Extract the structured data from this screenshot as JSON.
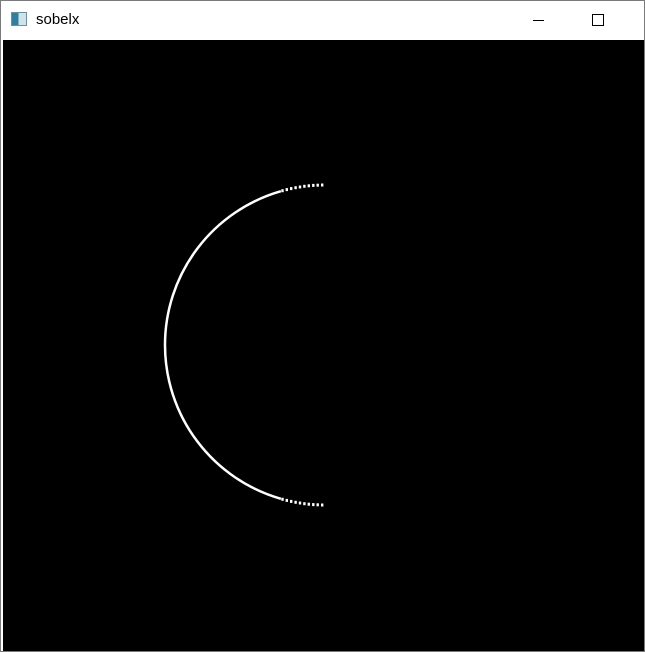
{
  "window": {
    "title": "sobelx",
    "icon": "app-window-icon",
    "controls": [
      "minimize-icon",
      "maximize-icon"
    ]
  },
  "image": {
    "background_color": "#000000",
    "edge_color": "#ffffff",
    "content": "left-half-circle-edge"
  }
}
